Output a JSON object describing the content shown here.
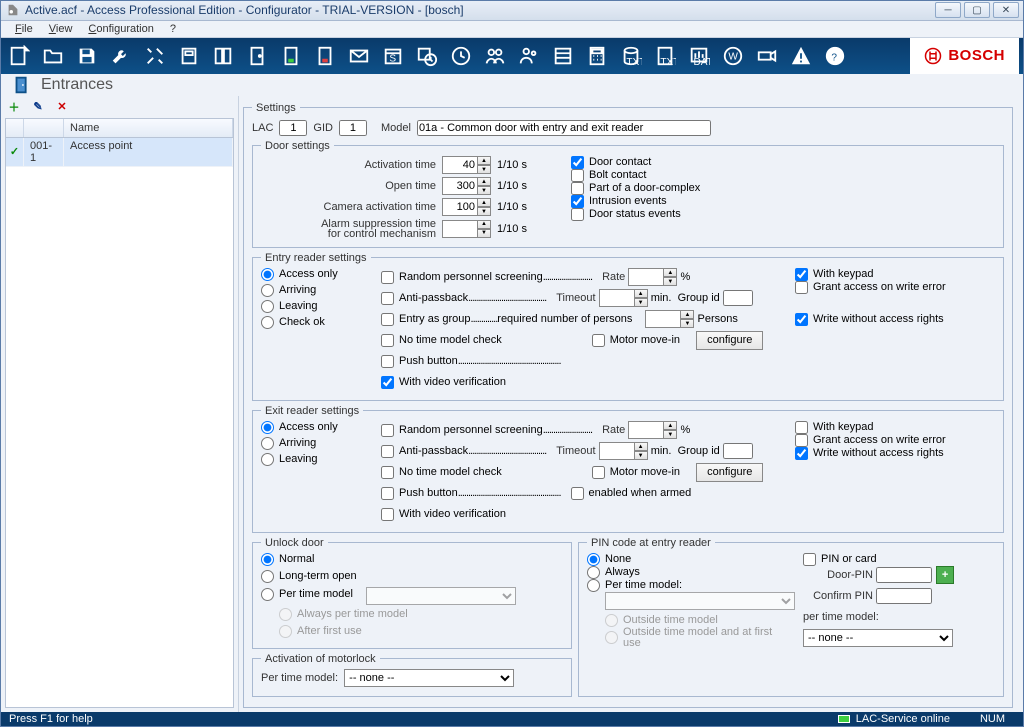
{
  "window": {
    "title": "Active.acf - Access Professional Edition - Configurator - TRIAL-VERSION - [bosch]"
  },
  "menu": {
    "file": "File",
    "view": "View",
    "configuration": "Configuration",
    "help": "?"
  },
  "brand": "BOSCH",
  "section_title": "Entrances",
  "table": {
    "col_blank": " ",
    "col_name": "Name",
    "rows": [
      {
        "id": "001-1",
        "name": "Access point"
      }
    ]
  },
  "settings": {
    "legend": "Settings",
    "lac_label": "LAC",
    "lac": "1",
    "gid_label": "GID",
    "gid": "1",
    "model_label": "Model",
    "model": "01a - Common door with entry and exit reader"
  },
  "door": {
    "legend": "Door settings",
    "activation_time_label": "Activation time",
    "activation_time": "40",
    "open_time_label": "Open time",
    "open_time": "300",
    "camera_time_label": "Camera activation time",
    "camera_time": "100",
    "alarm_supp_label1": "Alarm suppression time",
    "alarm_supp_label2": "for control mechanism",
    "alarm_supp": "",
    "unit": "1/10 s",
    "door_contact": "Door contact",
    "bolt_contact": "Bolt contact",
    "door_complex": "Part of a door-complex",
    "intrusion": "Intrusion events",
    "door_status": "Door status events"
  },
  "entry": {
    "legend": "Entry reader settings",
    "access_only": "Access only",
    "arriving": "Arriving",
    "leaving": "Leaving",
    "check_ok": "Check ok",
    "random_screening": "Random personnel screening",
    "rate": "Rate",
    "pct": "%",
    "anti_passback": "Anti-passback",
    "timeout": "Timeout",
    "min": "min.",
    "group_id": "Group id",
    "entry_group": "Entry as group",
    "req_persons": "required number of persons",
    "persons": "Persons",
    "no_time_model": "No time model check",
    "motor_movein": "Motor move-in",
    "configure": "configure",
    "push_button": "Push button",
    "video_verif": "With video verification",
    "with_keypad": "With keypad",
    "grant_write_err": "Grant access on write error",
    "write_no_rights": "Write without access rights"
  },
  "exit": {
    "legend": "Exit reader settings",
    "enabled_armed": "enabled when armed"
  },
  "unlock": {
    "legend": "Unlock door",
    "normal": "Normal",
    "long_term": "Long-term open",
    "per_time_model": "Per time model",
    "always_ptm": "Always per time model",
    "after_first": "After first use"
  },
  "motorlock": {
    "legend": "Activation of motorlock",
    "per_time_model": "Per time model:",
    "none": "-- none --"
  },
  "pin": {
    "legend": "PIN code at entry reader",
    "none": "None",
    "always": "Always",
    "per_time_model": "Per time model:",
    "outside_tm": "Outside time model",
    "outside_tm_first": "Outside time model and at first use",
    "pin_or_card": "PIN or card",
    "door_pin": "Door-PIN",
    "confirm_pin": "Confirm PIN",
    "ptm_label": "per time model:",
    "none_opt": "-- none --"
  },
  "status": {
    "help": "Press F1 for help",
    "service": "LAC-Service online",
    "num": "NUM"
  }
}
